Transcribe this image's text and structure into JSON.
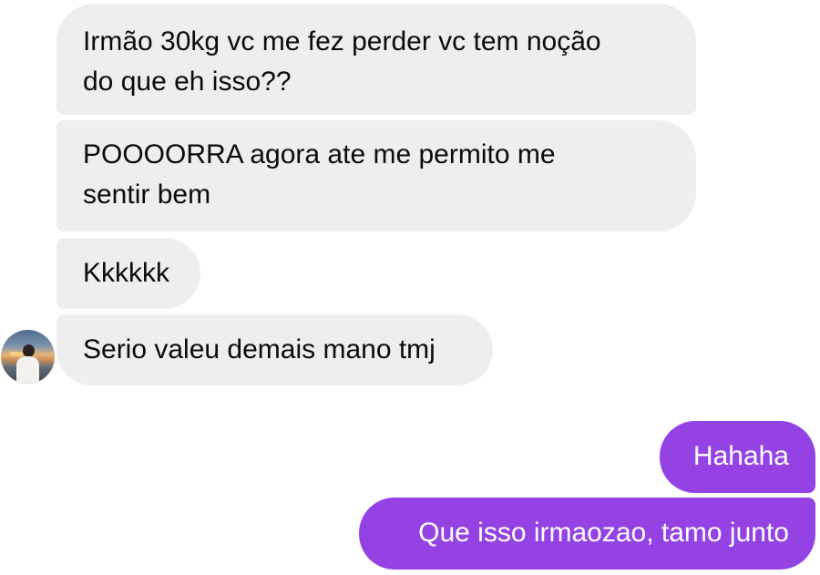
{
  "conversation": {
    "received": [
      {
        "lines": [
          "Irmão 30kg vc me fez perder vc tem noção",
          "do que eh isso??"
        ]
      },
      {
        "lines": [
          "POOOORRA agora ate me permito me",
          "sentir bem"
        ]
      },
      {
        "lines": [
          "Kkkkkk"
        ]
      },
      {
        "lines": [
          "Serio valeu demais mano tmj"
        ]
      }
    ],
    "sent": [
      {
        "text": "Hahaha"
      },
      {
        "text": "Que isso irmaozao, tamo junto"
      }
    ]
  },
  "colors": {
    "received_bubble": "#eeeef0",
    "sent_bubble": "#9442e4",
    "received_text": "#0b0b0b",
    "sent_text": "#ffffff"
  }
}
